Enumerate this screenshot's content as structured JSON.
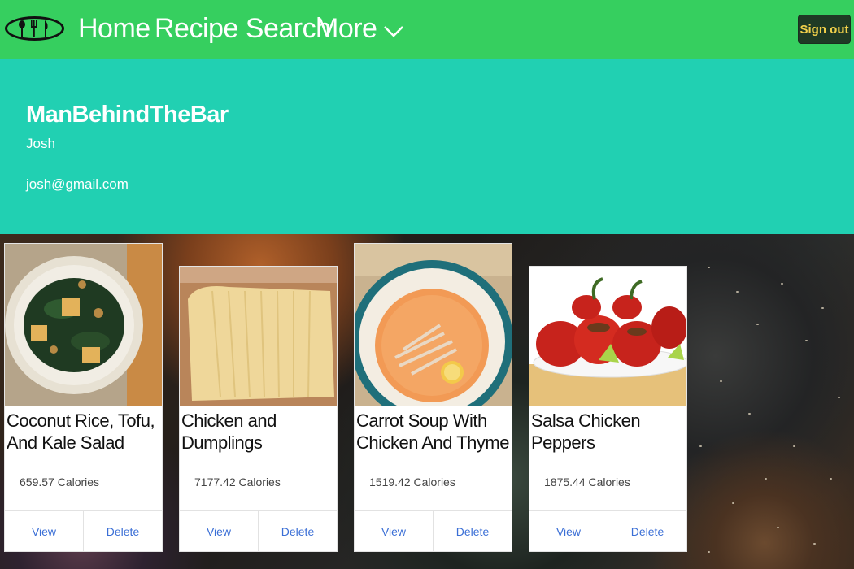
{
  "nav": {
    "home": "Home",
    "recipe_search": "Recipe Search",
    "more": "More",
    "sign_out": "Sign out"
  },
  "profile": {
    "username": "ManBehindTheBar",
    "name": "Josh",
    "email": "josh@gmail.com"
  },
  "recipes": [
    {
      "title": "Coconut Rice, Tofu, And Kale Salad",
      "calories": "659.57 Calories",
      "view": "View",
      "delete": "Delete"
    },
    {
      "title": "Chicken and Dumplings",
      "calories": "7177.42 Calories",
      "view": "View",
      "delete": "Delete"
    },
    {
      "title": "Carrot Soup With Chicken And Thyme",
      "calories": "1519.42 Calories",
      "view": "View",
      "delete": "Delete"
    },
    {
      "title": "Salsa Chicken Peppers",
      "calories": "1875.44 Calories",
      "view": "View",
      "delete": "Delete"
    }
  ],
  "colors": {
    "navbar": "#36cf5f",
    "profile_banner": "#21d0b2",
    "sign_out_bg": "#1f3a25",
    "sign_out_text": "#f1d04b",
    "link_blue": "#3b6fd6"
  },
  "icons": {
    "logo": "utensils-logo-icon",
    "more": "chevron-down-icon"
  }
}
